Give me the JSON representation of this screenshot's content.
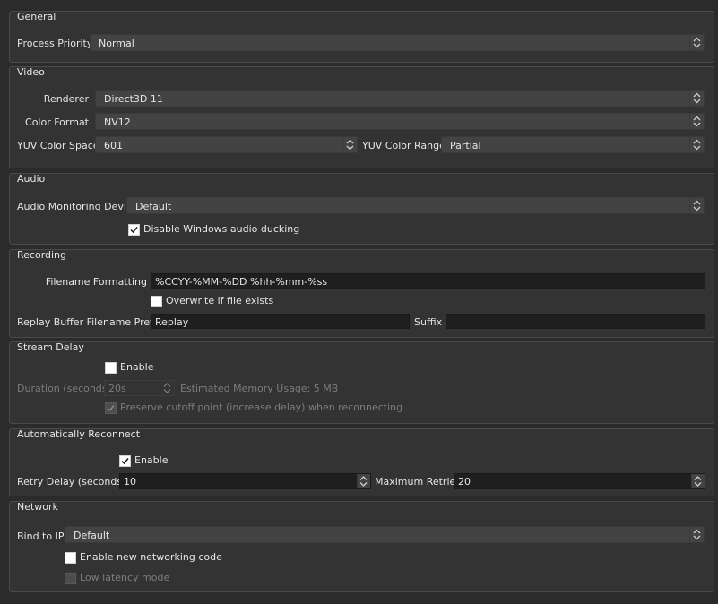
{
  "general": {
    "title": "General",
    "process_priority_label": "Process Priority",
    "process_priority_value": "Normal"
  },
  "video": {
    "title": "Video",
    "renderer_label": "Renderer",
    "renderer_value": "Direct3D 11",
    "color_format_label": "Color Format",
    "color_format_value": "NV12",
    "yuv_space_label": "YUV Color Space",
    "yuv_space_value": "601",
    "yuv_range_label": "YUV Color Range",
    "yuv_range_value": "Partial"
  },
  "audio": {
    "title": "Audio",
    "monitoring_label": "Audio Monitoring Device",
    "monitoring_value": "Default",
    "ducking_label": "Disable Windows audio ducking",
    "ducking_checked": true
  },
  "recording": {
    "title": "Recording",
    "filename_label": "Filename Formatting",
    "filename_value": "%CCYY-%MM-%DD %hh-%mm-%ss",
    "overwrite_label": "Overwrite if file exists",
    "overwrite_checked": false,
    "replay_prefix_label": "Replay Buffer Filename Prefix",
    "replay_prefix_value": "Replay",
    "suffix_label": "Suffix",
    "suffix_value": ""
  },
  "stream_delay": {
    "title": "Stream Delay",
    "enable_label": "Enable",
    "enable_checked": false,
    "duration_label": "Duration (seconds)",
    "duration_value": "20s",
    "memory_label": "Estimated Memory Usage: 5 MB",
    "preserve_label": "Preserve cutoff point (increase delay) when reconnecting",
    "preserve_checked": true
  },
  "reconnect": {
    "title": "Automatically Reconnect",
    "enable_label": "Enable",
    "enable_checked": true,
    "retry_delay_label": "Retry Delay (seconds)",
    "retry_delay_value": "10",
    "max_retries_label": "Maximum Retries",
    "max_retries_value": "20"
  },
  "network": {
    "title": "Network",
    "bind_ip_label": "Bind to IP",
    "bind_ip_value": "Default",
    "new_net_label": "Enable new networking code",
    "new_net_checked": false,
    "low_latency_label": "Low latency mode",
    "low_latency_checked": false
  },
  "colors": {
    "background": "#2b2b2b",
    "group": "#333333",
    "combo": "#434343",
    "edit": "#1f1f1f",
    "text": "#e6e6e6",
    "disabled_text": "#7c7c7c"
  }
}
